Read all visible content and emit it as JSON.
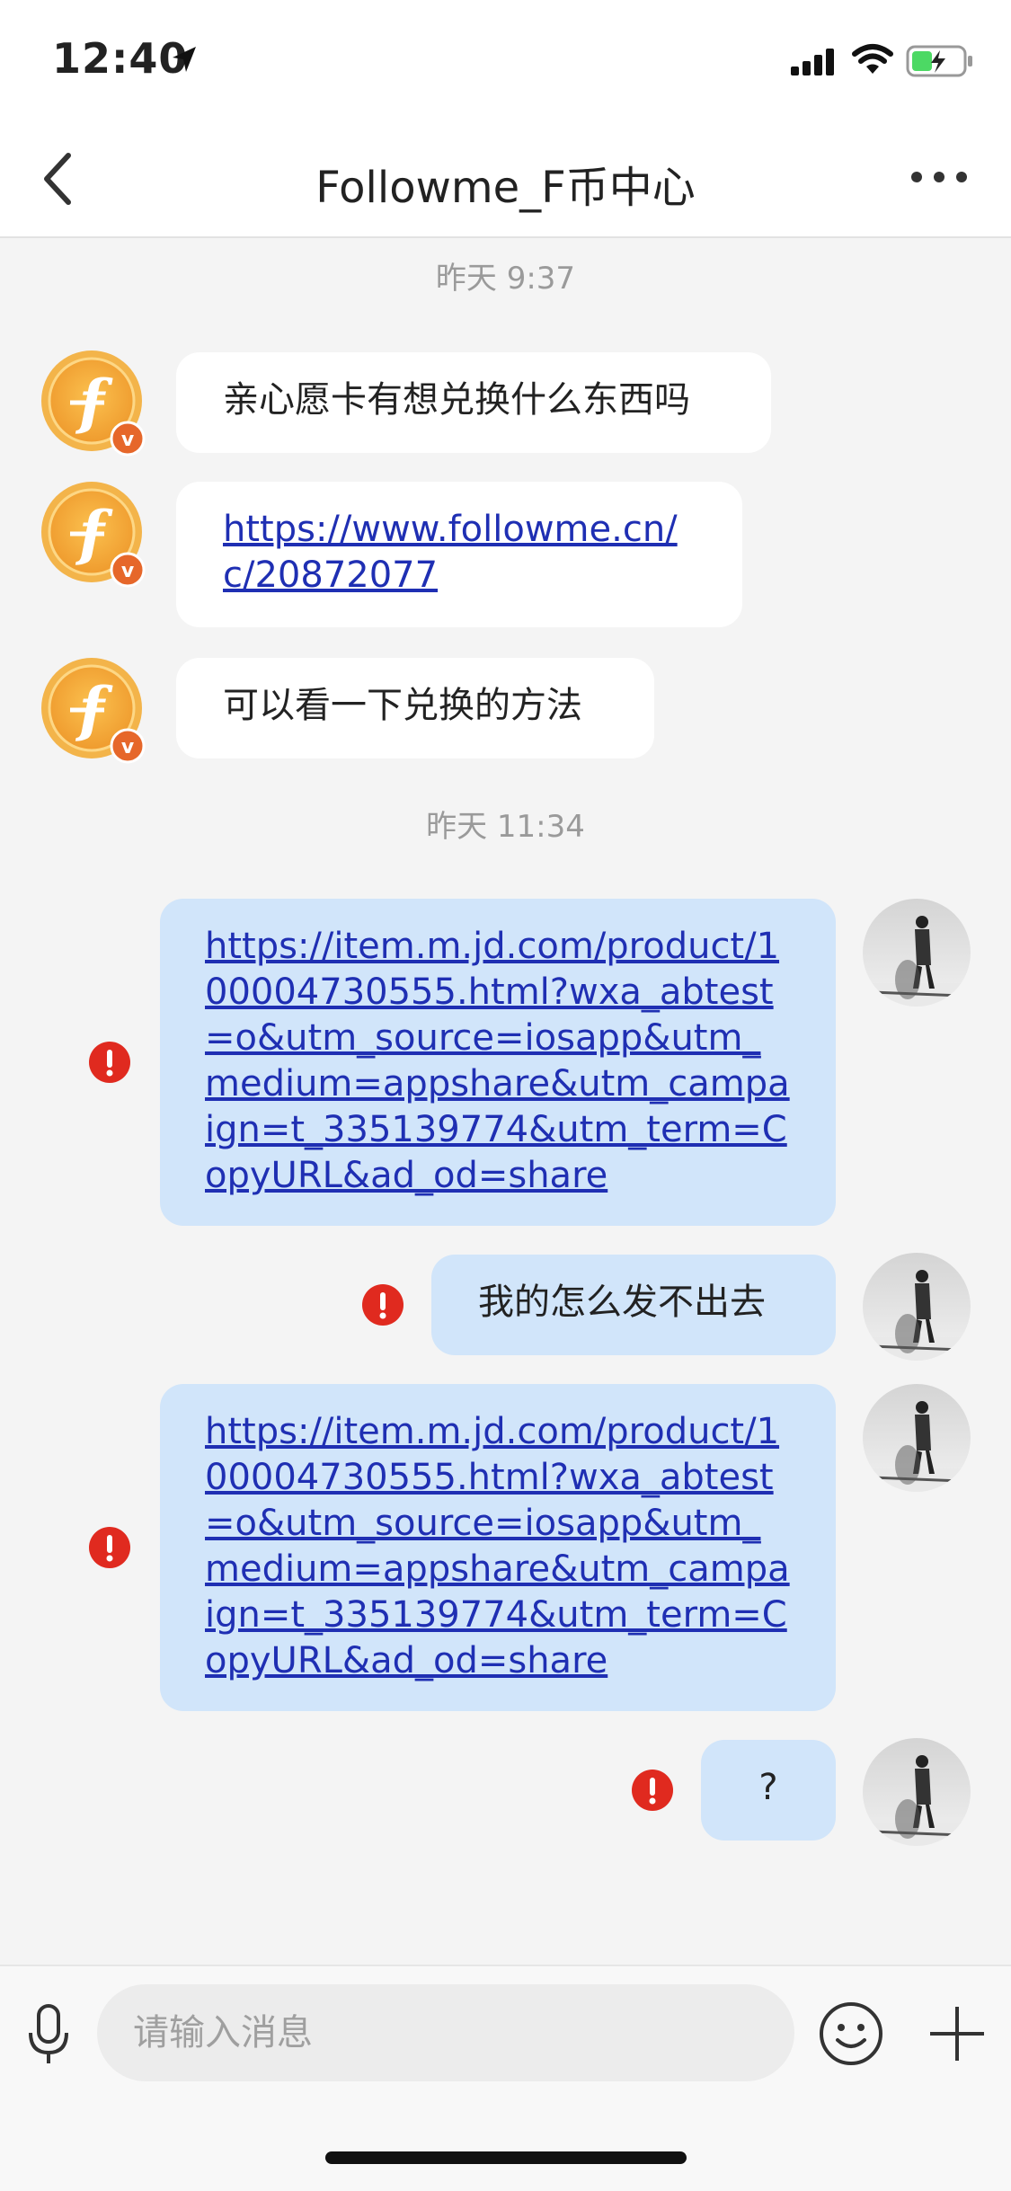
{
  "status_bar": {
    "time": "12:40"
  },
  "nav": {
    "title": "Followme_F币中心"
  },
  "chat": {
    "timestamps": [
      "昨天 9:37",
      "昨天 11:34"
    ],
    "incoming": [
      {
        "text": "亲心愿卡有想兑换什么东西吗"
      },
      {
        "link": "https://www.followme.cn/c/20872077"
      },
      {
        "text": "可以看一下兑换的方法"
      }
    ],
    "outgoing": [
      {
        "link": "https://item.m.jd.com/product/100004730555.html?wxa_abtest=o&utm_source=iosapp&utm_medium=appshare&utm_campaign=t_335139774&utm_term=CopyURL&ad_od=share",
        "status": "failed"
      },
      {
        "text": "我的怎么发不出去",
        "status": "failed"
      },
      {
        "link": "https://item.m.jd.com/product/100004730555.html?wxa_abtest=o&utm_source=iosapp&utm_medium=appshare&utm_campaign=t_335139774&utm_term=CopyURL&ad_od=share",
        "status": "failed"
      },
      {
        "text": "?",
        "status": "failed"
      }
    ]
  },
  "input": {
    "placeholder": "请输入消息"
  },
  "colors": {
    "coin_orange": "#f0a233",
    "badge_orange": "#e6672a",
    "error_red": "#e02a1f",
    "outgoing_bubble": "#d1e5fa",
    "link": "#1f2fb3"
  }
}
